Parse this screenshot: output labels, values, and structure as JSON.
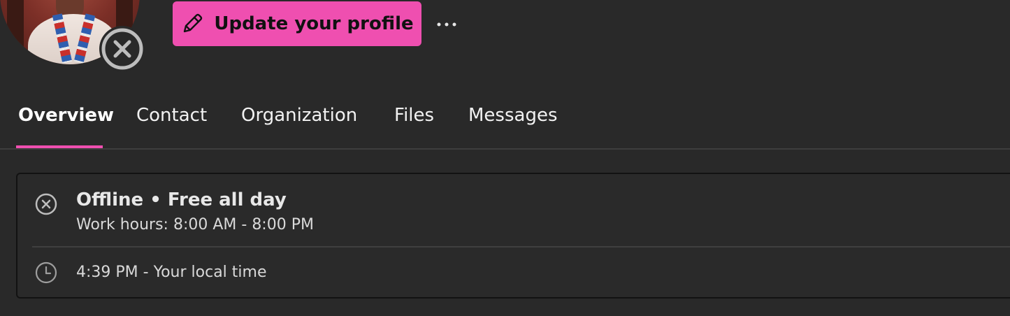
{
  "profile": {
    "update_label": "Update your profile",
    "more_label": "···",
    "accent_color": "#ef4fb0"
  },
  "icons": {
    "avatar": "user-photo",
    "presence": "offline-x-icon",
    "edit": "pencil-icon",
    "more": "more-horizontal-icon",
    "status": "offline-x-icon",
    "time": "clock-icon"
  },
  "tabs": [
    {
      "label": "Overview",
      "active": true
    },
    {
      "label": "Contact",
      "active": false
    },
    {
      "label": "Organization",
      "active": false
    },
    {
      "label": "Files",
      "active": false
    },
    {
      "label": "Messages",
      "active": false
    }
  ],
  "status_card": {
    "title": "Offline • Free all day",
    "work_hours": "Work hours: 8:00 AM - 8:00 PM",
    "local_time": "4:39 PM - Your local time"
  }
}
